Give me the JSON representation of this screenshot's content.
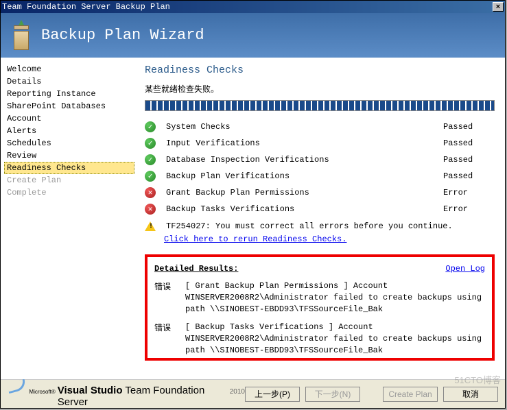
{
  "window": {
    "title": "Team Foundation Server Backup Plan"
  },
  "header": {
    "title": "Backup Plan Wizard"
  },
  "sidebar": {
    "items": [
      {
        "label": "Welcome",
        "state": "normal"
      },
      {
        "label": "Details",
        "state": "normal"
      },
      {
        "label": "Reporting Instance",
        "state": "normal"
      },
      {
        "label": "SharePoint Databases",
        "state": "normal"
      },
      {
        "label": "Account",
        "state": "normal"
      },
      {
        "label": "Alerts",
        "state": "normal"
      },
      {
        "label": "Schedules",
        "state": "normal"
      },
      {
        "label": "Review",
        "state": "normal"
      },
      {
        "label": "Readiness Checks",
        "state": "selected"
      },
      {
        "label": "Create Plan",
        "state": "disabled"
      },
      {
        "label": "Complete",
        "state": "disabled"
      }
    ]
  },
  "main": {
    "title": "Readiness Checks",
    "subtitle": "某些就绪检查失败。",
    "checks": [
      {
        "label": "System Checks",
        "status": "Passed",
        "icon": "pass"
      },
      {
        "label": "Input Verifications",
        "status": "Passed",
        "icon": "pass"
      },
      {
        "label": "Database Inspection Verifications",
        "status": "Passed",
        "icon": "pass"
      },
      {
        "label": "Backup Plan Verifications",
        "status": "Passed",
        "icon": "pass"
      },
      {
        "label": "Grant Backup Plan Permissions",
        "status": "Error",
        "icon": "error"
      },
      {
        "label": "Backup Tasks Verifications",
        "status": "Error",
        "icon": "error"
      }
    ],
    "warning": "TF254027: You must correct all errors before you continue.",
    "rerun": "Click here to rerun Readiness Checks.",
    "results": {
      "title": "Detailed Results:",
      "open_log": "Open Log",
      "rows": [
        {
          "label": "错误",
          "text": "[ Grant Backup Plan Permissions ] Account WINSERVER2008R2\\Administrator failed to create backups using path \\\\SINOBEST-EBDD93\\TFSSourceFile_Bak"
        },
        {
          "label": "错误",
          "text": "[ Backup Tasks Verifications ] Account WINSERVER2008R2\\Administrator failed to create backups using path \\\\SINOBEST-EBDD93\\TFSSourceFile_Bak"
        }
      ]
    }
  },
  "footer": {
    "microsoft": "Microsoft®",
    "product": "Visual Studio",
    "product_suffix": " Team Foundation Server",
    "year": "2010",
    "buttons": {
      "back": "上一步(P)",
      "next": "下一步(N)",
      "create": "Create Plan",
      "cancel": "取消"
    }
  },
  "watermark": "51CTO博客"
}
